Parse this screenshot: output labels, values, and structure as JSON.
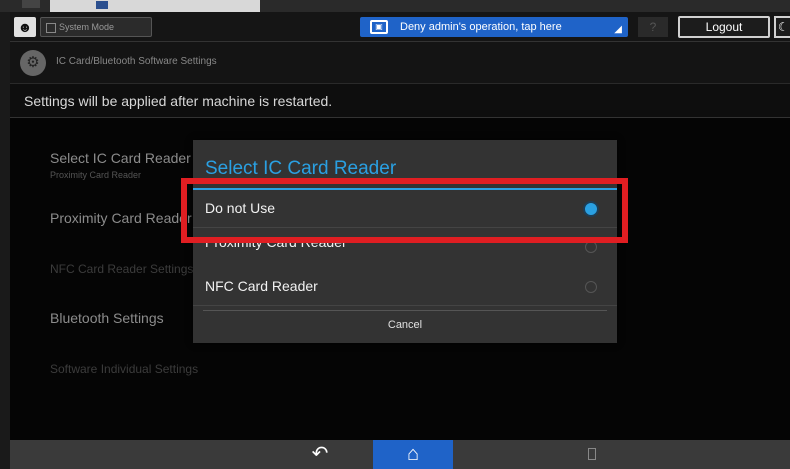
{
  "topbar": {
    "system_mode_label": "System Mode",
    "deny_label": "Deny admin's operation, tap here",
    "help_label": "?",
    "logout_label": "Logout"
  },
  "title": "IC Card/Bluetooth Software Settings",
  "notice": "Settings will be applied after machine is restarted.",
  "settings": [
    {
      "label": "Select IC Card Reader",
      "sub": "Proximity Card Reader"
    },
    {
      "label": "Proximity Card Reader Settings"
    },
    {
      "label": "NFC Card Reader Settings"
    },
    {
      "label": "Bluetooth Settings"
    },
    {
      "label": "Software Individual Settings"
    }
  ],
  "dialog": {
    "title": "Select IC Card Reader",
    "options": [
      {
        "label": "Do not Use",
        "selected": true
      },
      {
        "label": "Proximity Card Reader",
        "selected": false
      },
      {
        "label": "NFC Card Reader",
        "selected": false
      }
    ],
    "cancel_label": "Cancel"
  },
  "icons": {
    "user": "user-icon",
    "gear": "gear-icon",
    "back": "back-arrow-icon",
    "home": "home-icon"
  },
  "colors": {
    "accent": "#2aa0e2",
    "banner": "#1f63c8",
    "highlight": "#e01e22"
  }
}
